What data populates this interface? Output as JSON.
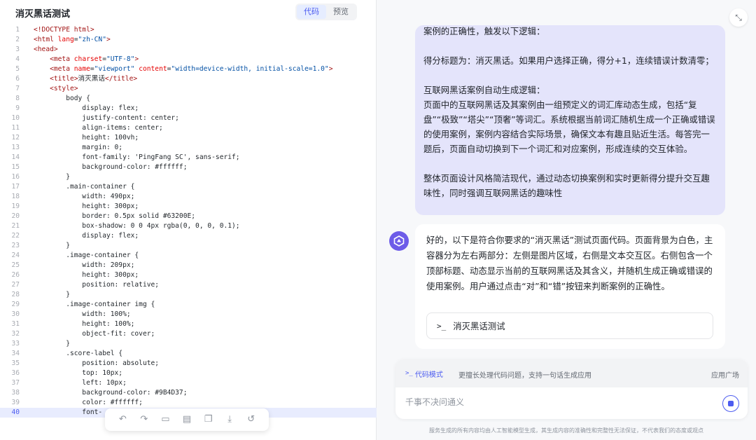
{
  "left_panel": {
    "title": "消灭黑话测试",
    "tabs": [
      {
        "label": "代码",
        "active": true
      },
      {
        "label": "预览",
        "active": false
      }
    ],
    "active_line": 40,
    "code_lines": [
      {
        "n": "1",
        "parts": [
          {
            "c": "t",
            "x": "<!DOCTYPE html>"
          }
        ]
      },
      {
        "n": "2",
        "parts": [
          {
            "c": "t",
            "x": "<html "
          },
          {
            "c": "a",
            "x": "lang"
          },
          {
            "c": "p",
            "x": "="
          },
          {
            "c": "v",
            "x": "\"zh-CN\""
          },
          {
            "c": "t",
            "x": ">"
          }
        ]
      },
      {
        "n": "3",
        "parts": [
          {
            "c": "t",
            "x": "<head>"
          }
        ]
      },
      {
        "n": "4",
        "parts": [
          {
            "c": "p",
            "x": "    "
          },
          {
            "c": "t",
            "x": "<meta "
          },
          {
            "c": "a",
            "x": "charset"
          },
          {
            "c": "p",
            "x": "="
          },
          {
            "c": "v",
            "x": "\"UTF-8\""
          },
          {
            "c": "t",
            "x": ">"
          }
        ]
      },
      {
        "n": "5",
        "parts": [
          {
            "c": "p",
            "x": "    "
          },
          {
            "c": "t",
            "x": "<meta "
          },
          {
            "c": "a",
            "x": "name"
          },
          {
            "c": "p",
            "x": "="
          },
          {
            "c": "v",
            "x": "\"viewport\""
          },
          {
            "c": "p",
            "x": " "
          },
          {
            "c": "a",
            "x": "content"
          },
          {
            "c": "p",
            "x": "="
          },
          {
            "c": "v",
            "x": "\"width=device-width, initial-scale=1.0\""
          },
          {
            "c": "t",
            "x": ">"
          }
        ]
      },
      {
        "n": "6",
        "parts": [
          {
            "c": "p",
            "x": "    "
          },
          {
            "c": "t",
            "x": "<title>"
          },
          {
            "c": "p",
            "x": "消灭黑话"
          },
          {
            "c": "t",
            "x": "</title>"
          }
        ]
      },
      {
        "n": "7",
        "parts": [
          {
            "c": "p",
            "x": "    "
          },
          {
            "c": "t",
            "x": "<style>"
          }
        ]
      },
      {
        "n": "8",
        "parts": [
          {
            "c": "p",
            "x": "        body {"
          }
        ]
      },
      {
        "n": "9",
        "parts": [
          {
            "c": "p",
            "x": "            display: flex;"
          }
        ]
      },
      {
        "n": "10",
        "parts": [
          {
            "c": "p",
            "x": "            justify-content: center;"
          }
        ]
      },
      {
        "n": "11",
        "parts": [
          {
            "c": "p",
            "x": "            align-items: center;"
          }
        ]
      },
      {
        "n": "12",
        "parts": [
          {
            "c": "p",
            "x": "            height: 100vh;"
          }
        ]
      },
      {
        "n": "13",
        "parts": [
          {
            "c": "p",
            "x": "            margin: 0;"
          }
        ]
      },
      {
        "n": "14",
        "parts": [
          {
            "c": "p",
            "x": "            font-family: 'PingFang SC', sans-serif;"
          }
        ]
      },
      {
        "n": "15",
        "parts": [
          {
            "c": "p",
            "x": "            background-color: #ffffff;"
          }
        ]
      },
      {
        "n": "16",
        "parts": [
          {
            "c": "p",
            "x": "        }"
          }
        ]
      },
      {
        "n": "17",
        "parts": [
          {
            "c": "p",
            "x": "        .main-container {"
          }
        ]
      },
      {
        "n": "18",
        "parts": [
          {
            "c": "p",
            "x": "            width: 490px;"
          }
        ]
      },
      {
        "n": "19",
        "parts": [
          {
            "c": "p",
            "x": "            height: 300px;"
          }
        ]
      },
      {
        "n": "20",
        "parts": [
          {
            "c": "p",
            "x": "            border: 0.5px solid #63200E;"
          }
        ]
      },
      {
        "n": "21",
        "parts": [
          {
            "c": "p",
            "x": "            box-shadow: 0 0 4px rgba(0, 0, 0, 0.1);"
          }
        ]
      },
      {
        "n": "22",
        "parts": [
          {
            "c": "p",
            "x": "            display: flex;"
          }
        ]
      },
      {
        "n": "23",
        "parts": [
          {
            "c": "p",
            "x": "        }"
          }
        ]
      },
      {
        "n": "24",
        "parts": [
          {
            "c": "p",
            "x": "        .image-container {"
          }
        ]
      },
      {
        "n": "25",
        "parts": [
          {
            "c": "p",
            "x": "            width: 209px;"
          }
        ]
      },
      {
        "n": "26",
        "parts": [
          {
            "c": "p",
            "x": "            height: 300px;"
          }
        ]
      },
      {
        "n": "27",
        "parts": [
          {
            "c": "p",
            "x": "            position: relative;"
          }
        ]
      },
      {
        "n": "28",
        "parts": [
          {
            "c": "p",
            "x": "        }"
          }
        ]
      },
      {
        "n": "29",
        "parts": [
          {
            "c": "p",
            "x": "        .image-container img {"
          }
        ]
      },
      {
        "n": "30",
        "parts": [
          {
            "c": "p",
            "x": "            width: 100%;"
          }
        ]
      },
      {
        "n": "31",
        "parts": [
          {
            "c": "p",
            "x": "            height: 100%;"
          }
        ]
      },
      {
        "n": "32",
        "parts": [
          {
            "c": "p",
            "x": "            object-fit: cover;"
          }
        ]
      },
      {
        "n": "33",
        "parts": [
          {
            "c": "p",
            "x": "        }"
          }
        ]
      },
      {
        "n": "34",
        "parts": [
          {
            "c": "p",
            "x": "        .score-label {"
          }
        ]
      },
      {
        "n": "35",
        "parts": [
          {
            "c": "p",
            "x": "            position: absolute;"
          }
        ]
      },
      {
        "n": "36",
        "parts": [
          {
            "c": "p",
            "x": "            top: 10px;"
          }
        ]
      },
      {
        "n": "37",
        "parts": [
          {
            "c": "p",
            "x": "            left: 10px;"
          }
        ]
      },
      {
        "n": "38",
        "parts": [
          {
            "c": "p",
            "x": "            background-color: #9B4D37;"
          }
        ]
      },
      {
        "n": "39",
        "parts": [
          {
            "c": "p",
            "x": "            color: #ffffff;"
          }
        ]
      },
      {
        "n": "40",
        "parts": [
          {
            "c": "p",
            "x": "            font-"
          }
        ]
      }
    ],
    "toolbar_icons": [
      "undo-icon",
      "redo-icon",
      "comment-icon",
      "document-icon",
      "copy-icon",
      "download-icon",
      "history-icon"
    ]
  },
  "chat": {
    "user_message": {
      "first_line": "案例的正确性，触发以下逻辑：",
      "paragraphs": [
        "得分标题为：消灭黑话。如果用户选择正确，得分+1，连续错误计数清零；",
        "互联网黑话案例自动生成逻辑：\n页面中的互联网黑话及其案例由一组预定义的词汇库动态生成，包括“复盘”“极致”“塔尖”“顶奢”等词汇。系统根据当前词汇随机生成一个正确或错误的使用案例，案例内容结合实际场景，确保文本有趣且贴近生活。每答完一题后，页面自动切换到下一个词汇和对应案例，形成连续的交互体验。",
        "整体页面设计风格简洁现代，通过动态切换案例和实时更新得分提升交互趣味性，同时强调互联网黑话的趣味性"
      ]
    },
    "assistant_message": {
      "text": "好的，以下是符合你要求的“消灭黑话”测试页面代码。页面背景为白色，主容器分为左右两部分：左侧是图片区域，右侧是文本交互区。右侧包含一个顶部标题、动态显示当前的互联网黑话及其含义，并随机生成正确或错误的使用案例。用户通过点击“对”和“错”按钮来判断案例的正确性。",
      "code_card_icon": ">_",
      "code_card_label": "消灭黑话测试"
    }
  },
  "input": {
    "mode_icon": ">_",
    "mode_label": "代码模式",
    "mode_description": "更擅长处理代码问题，支持一句话生成应用",
    "app_store_label": "应用广场",
    "placeholder": "千事不决问通义"
  },
  "footer": {
    "disclaimer": "服务生成的所有内容均由人工智能模型生成，其生成内容的准确性和完整性无法保证，不代表我们的态度或观点"
  },
  "colors": {
    "accent": "#4d5cf0",
    "user_bubble": "#e4e4fb",
    "bot_avatar": "#6d5ce8"
  }
}
